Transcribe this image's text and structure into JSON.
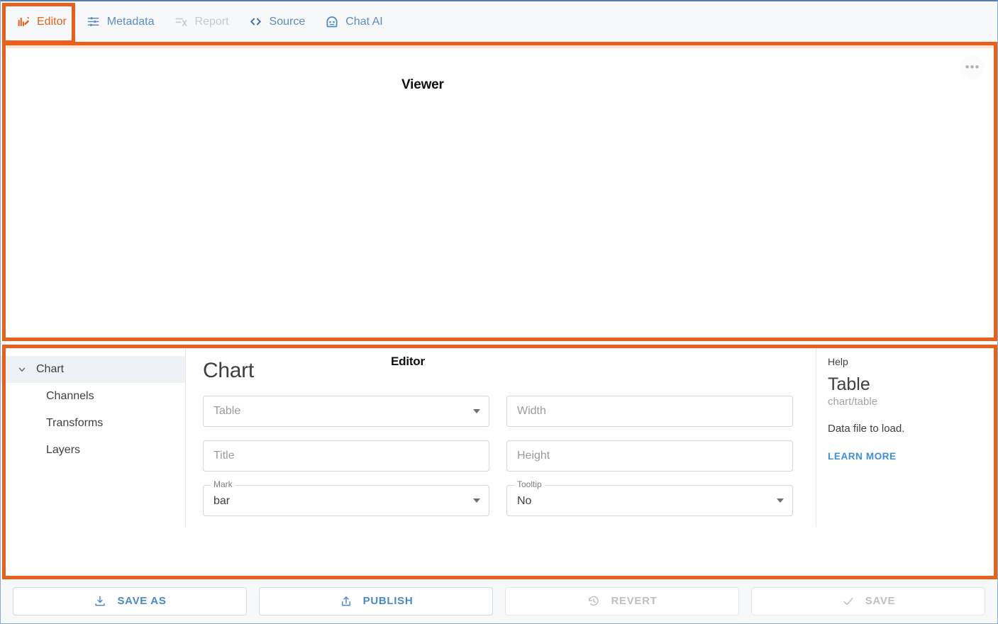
{
  "tabs": [
    {
      "id": "editor",
      "label": "Editor",
      "icon": "chart-edit-icon",
      "state": "active"
    },
    {
      "id": "metadata",
      "label": "Metadata",
      "icon": "tune-sliders-icon",
      "state": "enabled"
    },
    {
      "id": "report",
      "label": "Report",
      "icon": "report-lines-icon",
      "state": "disabled"
    },
    {
      "id": "source",
      "label": "Source",
      "icon": "code-brackets-icon",
      "state": "enabled"
    },
    {
      "id": "chatai",
      "label": "Chat AI",
      "icon": "robot-face-icon",
      "state": "enabled"
    }
  ],
  "viewer": {
    "annotation_label": "Viewer",
    "more_icon": "more-horizontal-icon"
  },
  "editor": {
    "annotation_label": "Editor",
    "nav": [
      {
        "label": "Chart",
        "level": "group",
        "expanded": true,
        "selected": true,
        "icon": "chevron-down-icon"
      },
      {
        "label": "Channels",
        "level": "child",
        "selected": false
      },
      {
        "label": "Transforms",
        "level": "child",
        "selected": false
      },
      {
        "label": "Layers",
        "level": "child",
        "selected": false
      }
    ],
    "form": {
      "title": "Chart",
      "fields": [
        {
          "name": "table",
          "kind": "select",
          "placeholder": "Table",
          "value": "",
          "floating_label": "",
          "icon": "chevron-down-icon"
        },
        {
          "name": "width",
          "kind": "text",
          "placeholder": "Width",
          "value": "",
          "floating_label": ""
        },
        {
          "name": "title",
          "kind": "text",
          "placeholder": "Title",
          "value": "",
          "floating_label": ""
        },
        {
          "name": "height",
          "kind": "text",
          "placeholder": "Height",
          "value": "",
          "floating_label": ""
        },
        {
          "name": "mark",
          "kind": "select",
          "placeholder": "",
          "value": "bar",
          "floating_label": "Mark",
          "icon": "chevron-down-icon"
        },
        {
          "name": "tooltip",
          "kind": "select",
          "placeholder": "",
          "value": "No",
          "floating_label": "Tooltip",
          "icon": "chevron-down-icon"
        }
      ]
    }
  },
  "help": {
    "kicker": "Help",
    "title": "Table",
    "subtitle": "chart/table",
    "description": "Data file to load.",
    "link_label": "LEARN MORE"
  },
  "footer": {
    "actions": [
      {
        "id": "save-as",
        "label": "SAVE AS",
        "icon": "download-icon",
        "disabled": false
      },
      {
        "id": "publish",
        "label": "PUBLISH",
        "icon": "upload-share-icon",
        "disabled": false
      },
      {
        "id": "revert",
        "label": "REVERT",
        "icon": "history-restore-icon",
        "disabled": true
      },
      {
        "id": "save",
        "label": "SAVE",
        "icon": "check-icon",
        "disabled": true
      }
    ]
  },
  "colors": {
    "accent_orange": "#e8601c",
    "link_blue": "#5b8cc0",
    "disabled_grey": "#c3c8cd",
    "nav_selected_bg": "#eef2f7"
  }
}
